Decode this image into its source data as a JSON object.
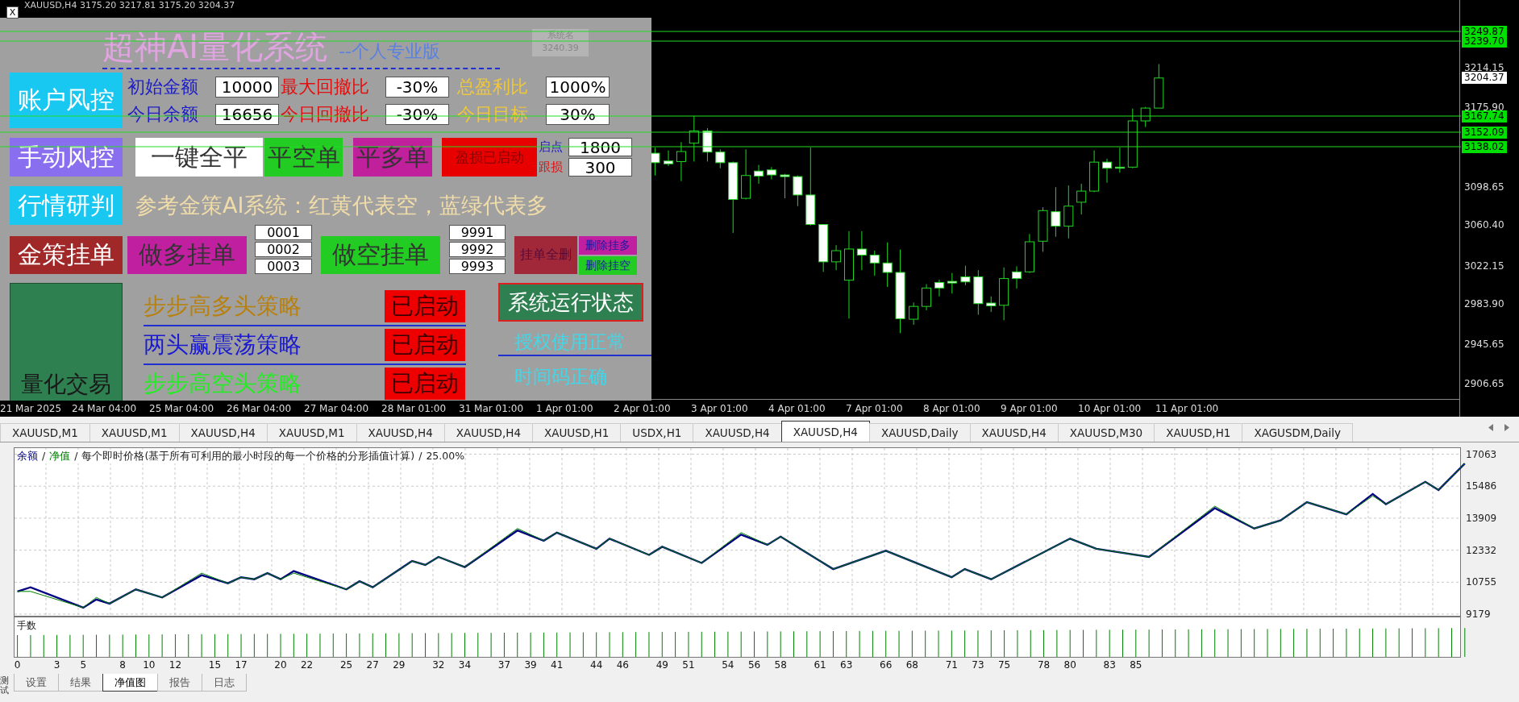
{
  "chart_header": "XAUUSD,H4  3175.20 3217.81 3175.20 3204.37",
  "panel": {
    "close_button": "X",
    "title": "超神AI量化系统",
    "subtitle": "--个人专业版",
    "tooltip": [
      "系统名",
      "3240.39"
    ],
    "account": {
      "button": "账户风控",
      "rows": [
        [
          {
            "label": "初始金额",
            "value": "10000",
            "color": "#1c1cc8"
          },
          {
            "label": "最大回撤比",
            "value": "-30%",
            "color": "#e01010"
          },
          {
            "label": "总盈利比",
            "value": "1000%",
            "color": "#f0c838"
          }
        ],
        [
          {
            "label": "今日余额",
            "value": "16656",
            "color": "#1c1cc8"
          },
          {
            "label": "今日回撤比",
            "value": "-30%",
            "color": "#e01010"
          },
          {
            "label": "今日目标",
            "value": "30%",
            "color": "#f0c838"
          }
        ]
      ]
    },
    "manual": {
      "button": "手动风控",
      "actions": [
        {
          "label": "一键全平",
          "color": "#ffffff"
        },
        {
          "label": "平空单",
          "color": "#22cc22"
        },
        {
          "label": "平多单",
          "color": "#c0209c"
        },
        {
          "label": "盈损已启动",
          "color": "#e80000"
        }
      ],
      "params": [
        {
          "label": "启点",
          "value": "1800",
          "color": "#1c1cc8"
        },
        {
          "label": "跟损",
          "value": "300",
          "color": "#e01010"
        }
      ]
    },
    "analysis": {
      "button": "行情研判",
      "note": "参考金策AI系统：红黄代表空，蓝绿代表多"
    },
    "orders": {
      "button": "金策挂单",
      "buy": {
        "label": "做多挂单",
        "ids": [
          "0001",
          "0002",
          "0003"
        ]
      },
      "sell": {
        "label": "做空挂单",
        "ids": [
          "9991",
          "9992",
          "9993"
        ]
      },
      "delete_all": "挂单全删",
      "delete_buy": "删除挂多",
      "delete_sell": "删除挂空"
    },
    "strategies": {
      "block": "量化交易",
      "items": [
        {
          "name": "步步高多头策略",
          "color": "#b8800c",
          "status": "已启动"
        },
        {
          "name": "两头赢震荡策略",
          "color": "#1a1ad0",
          "status": "已启动"
        },
        {
          "name": "步步高空头策略",
          "color": "#22ee22",
          "status": "已启动"
        }
      ]
    },
    "status": {
      "button": "系统运行状态",
      "lines": [
        "授权使用正常",
        "时间码正确"
      ]
    }
  },
  "price_axis": [
    {
      "label": "3249.87",
      "kind": "line"
    },
    {
      "label": "3239.70",
      "kind": "line"
    },
    {
      "label": "3214.15",
      "kind": "plain"
    },
    {
      "label": "3204.37",
      "kind": "current"
    },
    {
      "label": "3175.90",
      "kind": "plain"
    },
    {
      "label": "3167.74",
      "kind": "line"
    },
    {
      "label": "3152.09",
      "kind": "line"
    },
    {
      "label": "3138.02",
      "kind": "line"
    },
    {
      "label": "3098.65",
      "kind": "plain"
    },
    {
      "label": "3060.40",
      "kind": "plain"
    },
    {
      "label": "3022.15",
      "kind": "plain"
    },
    {
      "label": "2983.90",
      "kind": "plain"
    },
    {
      "label": "2945.65",
      "kind": "plain"
    },
    {
      "label": "2906.65",
      "kind": "plain"
    }
  ],
  "time_axis": [
    "21 Mar 2025",
    "24 Mar 04:00",
    "25 Mar 04:00",
    "26 Mar 04:00",
    "27 Mar 04:00",
    "28 Mar 01:00",
    "31 Mar 01:00",
    "1 Apr 01:00",
    "2 Apr 01:00",
    "3 Apr 01:00",
    "4 Apr 01:00",
    "7 Apr 01:00",
    "8 Apr 01:00",
    "9 Apr 01:00",
    "10 Apr 01:00",
    "11 Apr 01:00"
  ],
  "chart_tabs": [
    {
      "label": "XAUUSD,M1",
      "selected": false
    },
    {
      "label": "XAUUSD,M1",
      "selected": false
    },
    {
      "label": "XAUUSD,H4",
      "selected": false
    },
    {
      "label": "XAUUSD,M1",
      "selected": false
    },
    {
      "label": "XAUUSD,H4",
      "selected": false
    },
    {
      "label": "XAUUSD,H4",
      "selected": false
    },
    {
      "label": "XAUUSD,H1",
      "selected": false
    },
    {
      "label": "USDX,H1",
      "selected": false
    },
    {
      "label": "XAUUSD,H4",
      "selected": false
    },
    {
      "label": "XAUUSD,H4",
      "selected": true
    },
    {
      "label": "XAUUSD,Daily",
      "selected": false
    },
    {
      "label": "XAUUSD,H4",
      "selected": false
    },
    {
      "label": "XAUUSD,M30",
      "selected": false
    },
    {
      "label": "XAUUSD,H1",
      "selected": false
    },
    {
      "label": "XAGUSDM,Daily",
      "selected": false
    }
  ],
  "equity": {
    "separator": "/",
    "description": "每个即时价格(基于所有可利用的最小时段的每一个价格的分形插值计算)",
    "ratio": "25.00%",
    "chart_data": {
      "type": "line",
      "x": [
        0,
        1,
        5,
        6,
        7,
        9,
        11,
        14,
        16,
        17,
        18,
        19,
        20,
        21,
        25,
        26,
        27,
        30,
        31,
        32,
        34,
        38,
        40,
        41,
        44,
        45,
        48,
        49,
        52,
        55,
        57,
        58,
        60,
        62,
        66,
        71,
        72,
        74,
        80,
        82,
        86,
        91,
        94,
        96,
        98,
        101,
        103,
        104,
        107,
        108,
        110
      ],
      "series": [
        {
          "name": "余额",
          "color": "#000080",
          "values": [
            10300,
            10500,
            9500,
            9900,
            9700,
            10400,
            10000,
            11100,
            10700,
            11000,
            10900,
            11200,
            10900,
            11300,
            10400,
            10800,
            10500,
            11800,
            11600,
            12000,
            11500,
            13300,
            12800,
            13200,
            12400,
            12900,
            12100,
            12500,
            11700,
            13100,
            12600,
            13000,
            12200,
            11400,
            12300,
            11000,
            11400,
            10900,
            12900,
            12400,
            12000,
            14400,
            13400,
            13800,
            14700,
            14100,
            15100,
            14600,
            15700,
            15300,
            16600
          ]
        },
        {
          "name": "净值",
          "color": "#008000",
          "values": [
            10300,
            10300,
            9500,
            10000,
            9700,
            10400,
            10000,
            11200,
            10700,
            11000,
            10900,
            11200,
            10900,
            11200,
            10400,
            10800,
            10500,
            11800,
            11600,
            12000,
            11500,
            13400,
            12800,
            13200,
            12400,
            12900,
            12100,
            12500,
            11700,
            13200,
            12600,
            13000,
            12200,
            11400,
            12300,
            11000,
            11400,
            10900,
            12900,
            12400,
            12000,
            14500,
            13400,
            13800,
            14700,
            14100,
            15000,
            14600,
            15700,
            15300,
            16600
          ]
        }
      ],
      "grid": true,
      "xlim": [
        0,
        110
      ],
      "ylim": [
        9179,
        17063
      ],
      "yticks": [
        9179,
        10755,
        12332,
        13909,
        15486,
        17063
      ],
      "xticks": [
        0,
        3,
        5,
        8,
        10,
        12,
        15,
        17,
        20,
        22,
        25,
        27,
        29,
        32,
        34,
        37,
        39,
        41,
        44,
        46,
        49,
        51,
        54,
        56,
        58,
        61,
        63,
        66,
        68,
        71,
        73,
        75,
        78,
        80,
        83,
        85
      ]
    }
  },
  "lots": {
    "label": "手数"
  },
  "side_tab": "测试",
  "bottom_tabs": [
    {
      "label": "设置",
      "selected": false
    },
    {
      "label": "结果",
      "selected": false
    },
    {
      "label": "净值图",
      "selected": true
    },
    {
      "label": "报告",
      "selected": false
    },
    {
      "label": "日志",
      "selected": false
    }
  ]
}
